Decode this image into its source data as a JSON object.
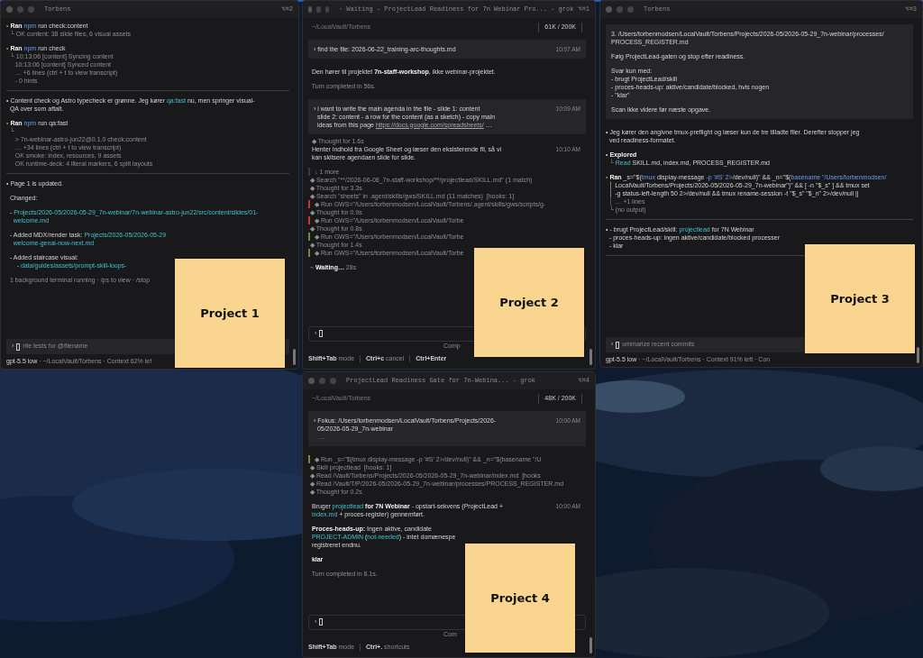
{
  "windows": [
    {
      "title": "Torbens",
      "shortcut": "⌥⌘2",
      "blocks": [
        {
          "kind": "line",
          "segs": [
            {
              "text": "• ",
              "kind": "ok"
            },
            {
              "text": "Ran ",
              "kind": "bold"
            },
            {
              "text": "npm",
              "kind": "cmd"
            },
            {
              "text": " run check:content",
              "kind": "normal"
            }
          ]
        },
        {
          "kind": "line",
          "segs": [
            {
              "text": "  └ OK content: 38 slide files, 6 visual assets",
              "kind": "dim"
            }
          ]
        },
        {
          "kind": "gap"
        },
        {
          "kind": "line",
          "segs": [
            {
              "text": "• ",
              "kind": "ok"
            },
            {
              "text": "Ran ",
              "kind": "bold"
            },
            {
              "text": "npm",
              "kind": "cmd"
            },
            {
              "text": " run check",
              "kind": "normal"
            }
          ]
        },
        {
          "kind": "line",
          "segs": [
            {
              "text": "  └ 10:13:06 [content] Syncing content",
              "kind": "dim"
            }
          ]
        },
        {
          "kind": "line",
          "segs": [
            {
              "text": "     10:13:06 [content] Synced content",
              "kind": "dim"
            }
          ]
        },
        {
          "kind": "line",
          "segs": [
            {
              "text": "     … +6 lines (ctrl + t to view transcript)",
              "kind": "dim"
            }
          ]
        },
        {
          "kind": "line",
          "segs": [
            {
              "text": "     - 0 hints",
              "kind": "dim"
            }
          ]
        },
        {
          "kind": "rule"
        },
        {
          "kind": "line",
          "segs": [
            {
              "text": "• Content check og Astro typecheck er grønne. Jeg kører ",
              "kind": "normal"
            },
            {
              "text": "qa:fast",
              "kind": "path"
            },
            {
              "text": " nu, men springer visual-",
              "kind": "normal"
            }
          ]
        },
        {
          "kind": "line",
          "segs": [
            {
              "text": "  QA over som aftalt.",
              "kind": "normal"
            }
          ]
        },
        {
          "kind": "gap"
        },
        {
          "kind": "line",
          "segs": [
            {
              "text": "• ",
              "kind": "ok"
            },
            {
              "text": "Ran ",
              "kind": "bold"
            },
            {
              "text": "npm",
              "kind": "cmd"
            },
            {
              "text": " run qa:fast",
              "kind": "normal"
            }
          ]
        },
        {
          "kind": "line",
          "segs": [
            {
              "text": "  └",
              "kind": "dim"
            }
          ]
        },
        {
          "kind": "line",
          "segs": [
            {
              "text": "     > 7n-webinar-astro-jun22@0.1.0 check:content",
              "kind": "dim"
            }
          ]
        },
        {
          "kind": "line",
          "segs": [
            {
              "text": "     … +34 lines (ctrl + t to view transcript)",
              "kind": "dim"
            }
          ]
        },
        {
          "kind": "line",
          "segs": [
            {
              "text": "     OK smoke: index, resources, 9 assets",
              "kind": "dim"
            }
          ]
        },
        {
          "kind": "line",
          "segs": [
            {
              "text": "     OK runtime-deck: 4 literal markers, 6 split layouts",
              "kind": "dim"
            }
          ]
        },
        {
          "kind": "rule"
        },
        {
          "kind": "line",
          "segs": [
            {
              "text": "• Page 1 is updated.",
              "kind": "normal"
            }
          ]
        },
        {
          "kind": "gap"
        },
        {
          "kind": "line",
          "segs": [
            {
              "text": "  Changed:",
              "kind": "normal"
            }
          ]
        },
        {
          "kind": "gap"
        },
        {
          "kind": "line",
          "segs": [
            {
              "text": "  - ",
              "kind": "normal"
            },
            {
              "text": "Projects/2026-05/2026-05-29_7n-webinar/7n-webinar-astro-jun22/src/content/slides/01-",
              "kind": "path"
            }
          ]
        },
        {
          "kind": "line",
          "segs": [
            {
              "text": "    welcome.md",
              "kind": "path"
            }
          ]
        },
        {
          "kind": "gap"
        },
        {
          "kind": "line",
          "segs": [
            {
              "text": "  - Added MDX/render task: ",
              "kind": "normal"
            },
            {
              "text": "Projects/2026-05/2026-05-29",
              "kind": "path"
            }
          ]
        },
        {
          "kind": "line",
          "segs": [
            {
              "text": "    welcome-genai-now-next.md",
              "kind": "path"
            }
          ]
        },
        {
          "kind": "gap"
        },
        {
          "kind": "line",
          "segs": [
            {
              "text": "  - Added staircase visual:",
              "kind": "normal"
            }
          ]
        },
        {
          "kind": "line",
          "segs": [
            {
              "text": "      - ",
              "kind": "normal"
            },
            {
              "text": "data/guides/assets/prompt-skill-loops-",
              "kind": "path"
            }
          ]
        },
        {
          "kind": "gap"
        },
        {
          "kind": "line",
          "segs": [
            {
              "text": "  1 background terminal running · /ps to view · /stop",
              "kind": "dim"
            }
          ]
        }
      ],
      "prompt": {
        "symbol": "›",
        "hint": "rite tests for @filename"
      },
      "status": [
        {
          "text": "gpt-5.5 low",
          "kind": "normal"
        },
        {
          "text": " · ~/LocalVault/Torbens · Context 62% lef",
          "kind": "dim"
        }
      ]
    },
    {
      "title": "· Waiting - ProjectLead Readiness for 7n Webinar Pro... - grok",
      "shortcut": "⌥⌘1",
      "header": {
        "path": "~/LocalVault/Torbens",
        "tokens": "61K / 200K"
      },
      "blocks": [
        {
          "kind": "user",
          "time": "10:07 AM",
          "lines": [
            {
              "kind": "line",
              "segs": [
                {
                  "text": "› find the file: 2026-06-22_training-arc-thoughts.md",
                  "kind": "normal"
                }
              ]
            }
          ]
        },
        {
          "kind": "gap"
        },
        {
          "kind": "line",
          "segs": [
            {
              "text": "  Den hører til projektet ",
              "kind": "normal"
            },
            {
              "text": "7n-staff-workshop",
              "kind": "bold"
            },
            {
              "text": ", ikke webinar-projektet.",
              "kind": "normal"
            }
          ]
        },
        {
          "kind": "gap"
        },
        {
          "kind": "line",
          "segs": [
            {
              "text": "  Turn completed in 56s.",
              "kind": "dim"
            }
          ]
        },
        {
          "kind": "gap"
        },
        {
          "kind": "user",
          "time": "10:09 AM",
          "lines": [
            {
              "kind": "line",
              "segs": [
                {
                  "text": "› i want to write the main agenda in the file - slide 1: content",
                  "kind": "normal"
                }
              ]
            },
            {
              "kind": "line",
              "segs": [
                {
                  "text": "  slide 2: content - a row for the content (as a sketch) - copy main",
                  "kind": "normal"
                }
              ]
            },
            {
              "kind": "line",
              "segs": [
                {
                  "text": "  ideas from this page ",
                  "kind": "normal"
                },
                {
                  "text": "https://docs.google.com/spreadsheets/",
                  "kind": "url"
                },
                {
                  "text": " …",
                  "kind": "normal"
                }
              ]
            }
          ]
        },
        {
          "kind": "line",
          "segs": [
            {
              "text": "  ◆ Thought for 1.6s",
              "kind": "dim"
            }
          ]
        },
        {
          "kind": "message",
          "time": "10:10 AM",
          "lines": [
            {
              "kind": "line",
              "segs": [
                {
                  "text": "  Henter indhold fra Google Sheet og læser den eksisterende fil, så vi",
                  "kind": "normal"
                }
              ]
            },
            {
              "kind": "line",
              "segs": [
                {
                  "text": "  kan skitsere agendaen slide for slide.",
                  "kind": "normal"
                }
              ]
            }
          ]
        },
        {
          "kind": "gap"
        },
        {
          "kind": "line",
          "color": "#3a3a3a",
          "segs": [
            {
              "text": " ↓ 1 more",
              "kind": "dim"
            }
          ]
        },
        {
          "kind": "line",
          "segs": [
            {
              "text": " ◆ Search \"**/2026-06-08_7n-staff-workshop/**/projectlead/SKILL.md\" (1 match)",
              "kind": "dim"
            }
          ]
        },
        {
          "kind": "line",
          "segs": [
            {
              "text": " ◆ Thought for 3.3s",
              "kind": "dim"
            }
          ]
        },
        {
          "kind": "line",
          "segs": [
            {
              "text": " ◆ Search \"sheets\" in .agent/skills/gws/SKILL.md (11 matches)  [hooks: 1]",
              "kind": "dim"
            }
          ]
        },
        {
          "kind": "line",
          "color": "#c0392b",
          "segs": [
            {
              "text": " ◆ Run GWS=\"/Users/torbenmodsen/LocalVault/Torbens/.agent/skills/gws/scripts/g-",
              "kind": "dim"
            }
          ]
        },
        {
          "kind": "line",
          "segs": [
            {
              "text": " ◆ Thought for 0.9s",
              "kind": "dim"
            }
          ]
        },
        {
          "kind": "line",
          "color": "#c0392b",
          "segs": [
            {
              "text": " ◆ Run GWS=\"/Users/torbenmodsen/LocalVault/Torbe",
              "kind": "dim"
            }
          ]
        },
        {
          "kind": "line",
          "segs": [
            {
              "text": " ◆ Thought for 0.8s",
              "kind": "dim"
            }
          ]
        },
        {
          "kind": "line",
          "color": "#6a8f3a",
          "segs": [
            {
              "text": " ◆ Run GWS=\"/Users/torbenmodsen/LocalVault/Torbe",
              "kind": "dim"
            }
          ]
        },
        {
          "kind": "line",
          "segs": [
            {
              "text": " ◆ Thought for 1.4s",
              "kind": "dim"
            }
          ]
        },
        {
          "kind": "line",
          "color": "#6a8f3a",
          "segs": [
            {
              "text": " ◆ Run GWS=\"/Users/torbenmodsen/LocalVault/Torbe",
              "kind": "dim"
            }
          ]
        },
        {
          "kind": "gap"
        },
        {
          "kind": "line",
          "segs": [
            {
              "text": " ⌁ ",
              "kind": "dim"
            },
            {
              "text": "Waiting…",
              "kind": "bold"
            },
            {
              "text": " 28s",
              "kind": "dim"
            }
          ]
        }
      ],
      "prompt": {
        "symbol": "›",
        "aside": "Comp"
      },
      "shortcuts": [
        {
          "key": "Shift+Tab",
          "label": "mode"
        },
        {
          "key": "Ctrl+c",
          "label": "cancel"
        },
        {
          "key": "Ctrl+Enter"
        }
      ]
    },
    {
      "title": "Torbens",
      "shortcut": "⌥⌘3",
      "blocks": [
        {
          "kind": "user",
          "lines": [
            {
              "kind": "line",
              "segs": [
                {
                  "text": "3. /Users/torbenmodsen/LocalVault/Torbens/Projects/2026-05/2026-05-29_7n-webinar/processes/",
                  "kind": "normal"
                }
              ]
            },
            {
              "kind": "line",
              "segs": [
                {
                  "text": "PROCESS_REGISTER.md",
                  "kind": "normal"
                }
              ]
            },
            {
              "kind": "gap"
            },
            {
              "kind": "line",
              "segs": [
                {
                  "text": "Følg ProjectLead-gaten og stop efter readiness.",
                  "kind": "normal"
                }
              ]
            },
            {
              "kind": "gap"
            },
            {
              "kind": "line",
              "segs": [
                {
                  "text": "Svar kun med:",
                  "kind": "normal"
                }
              ]
            },
            {
              "kind": "line",
              "segs": [
                {
                  "text": "- brugt ProjectLead/skill",
                  "kind": "normal"
                }
              ]
            },
            {
              "kind": "line",
              "segs": [
                {
                  "text": "- proces-heads-up: aktive/candidate/blocked, hvis nogen",
                  "kind": "normal"
                }
              ]
            },
            {
              "kind": "line",
              "segs": [
                {
                  "text": "- \"klar\"",
                  "kind": "normal"
                }
              ]
            },
            {
              "kind": "gap"
            },
            {
              "kind": "line",
              "segs": [
                {
                  "text": "Scan ikke videre før næste opgave.",
                  "kind": "normal"
                }
              ]
            }
          ]
        },
        {
          "kind": "gap"
        },
        {
          "kind": "line",
          "segs": [
            {
              "text": "• Jeg kører den angivne tmux-preflight og læser kun de tre tilladte filer. Derefter stopper jeg",
              "kind": "normal"
            }
          ]
        },
        {
          "kind": "line",
          "segs": [
            {
              "text": "  ved readiness-formatet.",
              "kind": "normal"
            }
          ]
        },
        {
          "kind": "gap"
        },
        {
          "kind": "line",
          "segs": [
            {
              "text": "• ",
              "kind": "normal"
            },
            {
              "text": "Explored",
              "kind": "bold"
            }
          ]
        },
        {
          "kind": "line",
          "segs": [
            {
              "text": "  └ ",
              "kind": "dim"
            },
            {
              "text": "Read",
              "kind": "path"
            },
            {
              "text": " SKILL.md, index.md, PROCESS_REGISTER.md",
              "kind": "normal"
            }
          ]
        },
        {
          "kind": "gap"
        },
        {
          "kind": "line",
          "segs": [
            {
              "text": "• ",
              "kind": "ok"
            },
            {
              "text": "Ran ",
              "kind": "bold"
            },
            {
              "text": "_s=\"$(",
              "kind": "normal"
            },
            {
              "text": "tmux",
              "kind": "cmd"
            },
            {
              "text": " display-message ",
              "kind": "normal"
            },
            {
              "text": "-p '#S' 2>",
              "kind": "cmd"
            },
            {
              "text": "/dev/null)\" && _n=\"$(",
              "kind": "normal"
            },
            {
              "text": "basename \"/Users/torbenmodsen/",
              "kind": "cmd"
            }
          ]
        },
        {
          "kind": "line",
          "segs": [
            {
              "text": "  │ LocalVault/Torbens/Projects/2026-05/2026-05-29_7n-webinar\")\" && [ -n \"$_s\" ] && tmux set",
              "kind": "normal"
            }
          ]
        },
        {
          "kind": "line",
          "segs": [
            {
              "text": "  │ -g status-left-length 50 2>/dev/null && tmux rename-session -t \"$_s\" \"$_n\" 2>/dev/null ||",
              "kind": "normal"
            }
          ]
        },
        {
          "kind": "line",
          "segs": [
            {
              "text": "  │ … +1 lines",
              "kind": "dim"
            }
          ]
        },
        {
          "kind": "line",
          "segs": [
            {
              "text": "  └ (no output)",
              "kind": "dim"
            }
          ]
        },
        {
          "kind": "rule"
        },
        {
          "kind": "line",
          "segs": [
            {
              "text": "• - brugt ProjectLead/skill: ",
              "kind": "normal"
            },
            {
              "text": "projectlead",
              "kind": "path"
            },
            {
              "text": " for 7N Webinar",
              "kind": "normal"
            }
          ]
        },
        {
          "kind": "line",
          "segs": [
            {
              "text": "  - proces-heads-up: ingen aktive/candidate/blocked processer",
              "kind": "normal"
            }
          ]
        },
        {
          "kind": "line",
          "segs": [
            {
              "text": "  - klar",
              "kind": "normal"
            }
          ]
        },
        {
          "kind": "rule"
        }
      ],
      "prompt": {
        "symbol": "›",
        "hint": "ummarize recent commits"
      },
      "status": [
        {
          "text": "gpt-5.5 low",
          "kind": "normal"
        },
        {
          "text": " · ~/LocalVault/Torbens · Context 91% left · Con",
          "kind": "dim"
        }
      ]
    },
    {
      "title": "ProjectLead Readiness Gate for 7n-Webina... - grok",
      "shortcut": "⌥⌘4",
      "header": {
        "path": "~/LocalVault/Torbens",
        "tokens": "48K / 200K"
      },
      "blocks": [
        {
          "kind": "user",
          "time": "10:00 AM",
          "lines": [
            {
              "kind": "line",
              "segs": [
                {
                  "text": "› Fokus: /Users/torbenmodsen/LocalVault/Torbens/Projects/2026-",
                  "kind": "normal"
                }
              ]
            },
            {
              "kind": "line",
              "segs": [
                {
                  "text": "  05/2026-05-29_7n-webinar",
                  "kind": "normal"
                }
              ]
            },
            {
              "kind": "line",
              "segs": [
                {
                  "text": "   …",
                  "kind": "dim"
                }
              ]
            }
          ]
        },
        {
          "kind": "gap"
        },
        {
          "kind": "line",
          "color": "#6a8f3a",
          "segs": [
            {
              "text": " ◆ Run _s=\"$(tmux display-message -p '#S' 2>/dev/null)\" && _n=\"$(basename \"/U",
              "kind": "dim"
            }
          ]
        },
        {
          "kind": "line",
          "segs": [
            {
              "text": " ◆ Skill projectlead  [hooks: 1]",
              "kind": "dim"
            }
          ]
        },
        {
          "kind": "line",
          "segs": [
            {
              "text": " ◆ Read /Vault/Torbens/Projects/2026-05/2026-05-29_7n-webinar/index.md  [hooks",
              "kind": "dim"
            }
          ]
        },
        {
          "kind": "line",
          "segs": [
            {
              "text": " ◆ Read /Vault/T/P/2026-05/2026-05-29_7n-webinar/processes/PROCESS_REGISTER.md",
              "kind": "dim"
            }
          ]
        },
        {
          "kind": "line",
          "segs": [
            {
              "text": " ◆ Thought for 0.2s",
              "kind": "dim"
            }
          ]
        },
        {
          "kind": "gap"
        },
        {
          "kind": "message",
          "time": "10:00 AM",
          "lines": [
            {
              "kind": "line",
              "segs": [
                {
                  "text": "  Bruger ",
                  "kind": "normal"
                },
                {
                  "text": "projectlead",
                  "kind": "path"
                },
                {
                  "text": " for 7N Webinar",
                  "kind": "bold"
                },
                {
                  "text": " - opstart-sekvens (ProjectLead +",
                  "kind": "normal"
                }
              ]
            },
            {
              "kind": "line",
              "segs": [
                {
                  "text": "  index.md",
                  "kind": "path"
                },
                {
                  "text": " + proces-register) gennemført.",
                  "kind": "normal"
                }
              ]
            }
          ]
        },
        {
          "kind": "gap"
        },
        {
          "kind": "line",
          "segs": [
            {
              "text": "  Proces-heads-up:",
              "kind": "bold"
            },
            {
              "text": " Ingen aktive, candidate",
              "kind": "normal"
            }
          ]
        },
        {
          "kind": "line",
          "segs": [
            {
              "text": "  PROJECT-ADMIN",
              "kind": "path"
            },
            {
              "text": " (",
              "kind": "normal"
            },
            {
              "text": "not-needed",
              "kind": "path"
            },
            {
              "text": ") - intet domænespe",
              "kind": "normal"
            }
          ]
        },
        {
          "kind": "line",
          "segs": [
            {
              "text": "  registreret endnu.",
              "kind": "normal"
            }
          ]
        },
        {
          "kind": "gap"
        },
        {
          "kind": "line",
          "segs": [
            {
              "text": "  klar",
              "kind": "bold"
            }
          ]
        },
        {
          "kind": "gap"
        },
        {
          "kind": "line",
          "segs": [
            {
              "text": "  Turn completed in 8.1s.",
              "kind": "dim"
            }
          ]
        }
      ],
      "prompt": {
        "symbol": "›",
        "aside": "Com"
      },
      "shortcuts": [
        {
          "key": "Shift+Tab",
          "label": "mode"
        },
        {
          "key": "Ctrl+.",
          "label": "shortcuts"
        }
      ]
    }
  ],
  "notes": [
    {
      "text": "Project 1"
    },
    {
      "text": "Project 2"
    },
    {
      "text": "Project 3"
    },
    {
      "text": "Project 4"
    }
  ]
}
